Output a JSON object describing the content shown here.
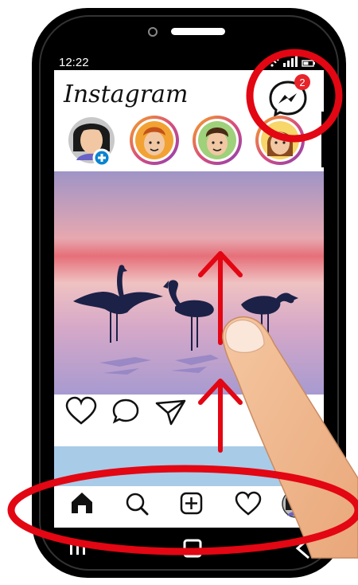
{
  "status_bar": {
    "time": "12:22"
  },
  "header": {
    "logo_text": "Instagram",
    "messenger_badge": "2"
  },
  "icons": {
    "messenger": "messenger-icon",
    "like": "heart-icon",
    "comment": "comment-icon",
    "share": "paper-plane-icon",
    "home": "home-icon",
    "search": "search-icon",
    "add": "add-post-icon",
    "activity": "heart-icon",
    "profile": "avatar"
  },
  "colors": {
    "story_ring": "#d94f7a",
    "badge": "#e8232a",
    "highlight_circle": "#e30613",
    "swipe_arrow": "#e30613",
    "add_story": "#0a84d1"
  }
}
